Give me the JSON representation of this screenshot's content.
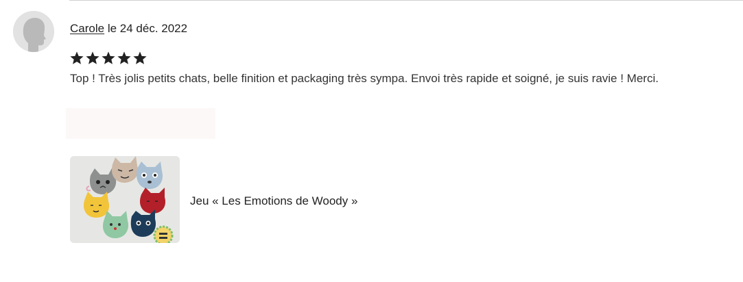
{
  "review": {
    "author": "Carole",
    "date_text": "le 24 déc. 2022",
    "rating": 5,
    "rating_max": 5,
    "text": "Top ! Très jolis petits chats, belle finition et packaging très sympa. Envoi très rapide et soigné, je suis ravie ! Merci."
  },
  "product": {
    "title": "Jeu « Les Emotions de Woody »"
  },
  "colors": {
    "text": "#222222",
    "star": "#222222",
    "avatar_bg": "#e2e2e2",
    "avatar_figure": "#b9b9b9",
    "divider": "#cfcfcf"
  },
  "icons": {
    "avatar": "user-silhouette-icon",
    "star": "star-icon"
  }
}
